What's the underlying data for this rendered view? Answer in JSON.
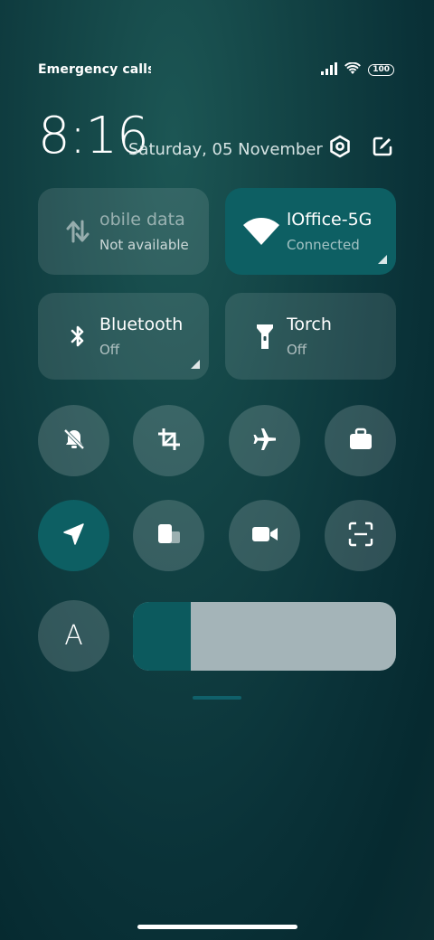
{
  "status": {
    "carrier": "Emergency calls o",
    "battery": "100"
  },
  "header": {
    "time": "8:16",
    "date": "Saturday, 05 November"
  },
  "tiles": [
    {
      "title": "obile data",
      "subtitle": "Not available",
      "icon": "mobile-data-icon",
      "active": false
    },
    {
      "title": "lOffice-5G",
      "subtitle": "Connected",
      "icon": "wifi-icon",
      "active": true
    },
    {
      "title": "Bluetooth",
      "subtitle": "Off",
      "icon": "bluetooth-icon",
      "active": false
    },
    {
      "title": "Torch",
      "subtitle": "Off",
      "icon": "torch-icon",
      "active": false
    }
  ],
  "toggles": [
    "mute-icon",
    "crop-icon",
    "airplane-icon",
    "briefcase-icon",
    "location-icon",
    "screen-cast-icon",
    "video-record-icon",
    "scan-icon",
    "auto-brightness-icon"
  ],
  "brightness": {
    "level": 0.22
  },
  "auto_brightness_label": "A",
  "colors": {
    "accent": "#0d5f63",
    "tile_bg": "rgba(255,255,255,0.11)",
    "slider_track": "#a4b4b8"
  }
}
